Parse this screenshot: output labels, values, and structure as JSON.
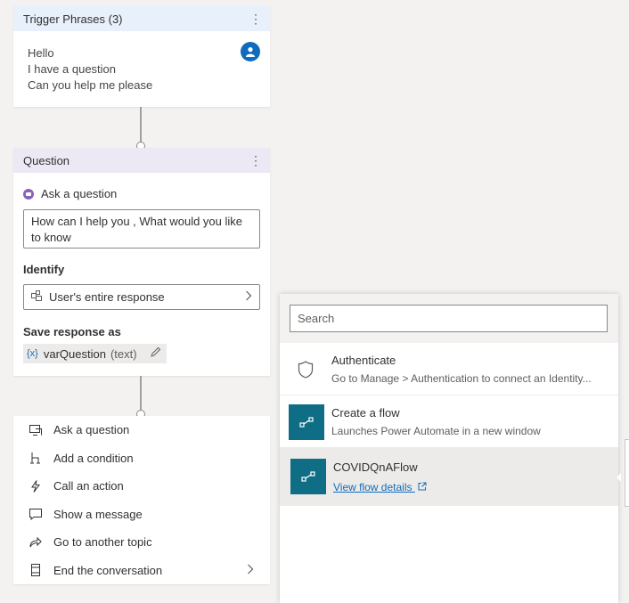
{
  "trigger": {
    "title": "Trigger Phrases (3)",
    "phrases": [
      "Hello",
      "I have a question",
      "Can you help me please"
    ]
  },
  "question": {
    "title": "Question",
    "ask_label": "Ask a question",
    "question_text": "How can I help you , What would you like to know",
    "identify_label": "Identify",
    "identify_value": "User's entire response",
    "save_label": "Save response as",
    "var_icon": "{x}",
    "var_name": "varQuestion",
    "var_type": "(text)"
  },
  "actions": [
    {
      "label": "Ask a question",
      "icon": "ask-question-icon"
    },
    {
      "label": "Add a condition",
      "icon": "condition-icon"
    },
    {
      "label": "Call an action",
      "icon": "lightning-icon"
    },
    {
      "label": "Show a message",
      "icon": "message-icon"
    },
    {
      "label": "Go to another topic",
      "icon": "redirect-icon"
    },
    {
      "label": "End the conversation",
      "icon": "end-icon"
    }
  ],
  "flow_panel": {
    "search_placeholder": "Search",
    "items": [
      {
        "title": "Authenticate",
        "subtitle": "Go to Manage > Authentication to connect an Identity..."
      },
      {
        "title": "Create a flow",
        "subtitle": "Launches Power Automate in a new window"
      },
      {
        "title": "COVIDQnAFlow",
        "link": "View flow details"
      }
    ]
  },
  "colors": {
    "accent": "#0f6cbd",
    "flow_icon_bg": "#0f6e86",
    "trigger_header": "#e8f0fb",
    "question_header": "#ece8f4"
  }
}
